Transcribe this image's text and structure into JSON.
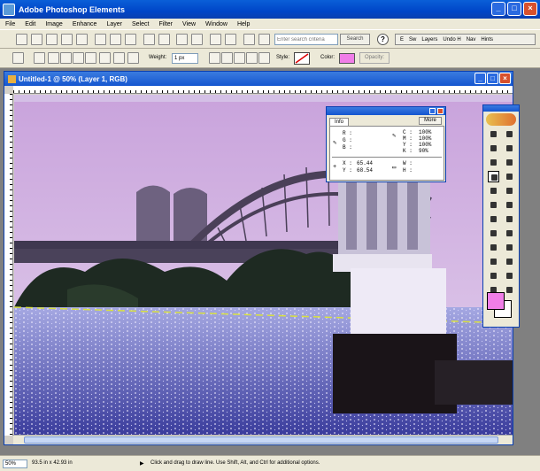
{
  "app": {
    "title": "Adobe Photoshop Elements"
  },
  "menu": [
    "File",
    "Edit",
    "Image",
    "Enhance",
    "Layer",
    "Select",
    "Filter",
    "View",
    "Window",
    "Help"
  ],
  "search": {
    "placeholder": "Enter search criteria",
    "button_label": "Search"
  },
  "palette_well": {
    "tabs": [
      "E",
      "Sw",
      "Layers",
      "Undo H",
      "Nav",
      "Hints"
    ]
  },
  "options": {
    "weight_label": "Weight:",
    "weight_value": "1 px",
    "style_label": "Style:",
    "color_label": "Color:",
    "opacity_label": "Opacity:",
    "color": "#f07ee8"
  },
  "document": {
    "title": "Untitled-1 @ 50% (Layer 1, RGB)"
  },
  "info_palette": {
    "tab": "Info",
    "more_button": "More",
    "r": "R :",
    "g": "G :",
    "b": "B :",
    "c": "C :",
    "m": "M :",
    "y": "Y :",
    "k": "K :",
    "c_val": "100%",
    "m_val": "100%",
    "y_val": "100%",
    "k_val": "90%",
    "x": "X :",
    "y_coord": "Y :",
    "x_val": "65.44",
    "y_val2": "68.54",
    "w": "W :",
    "h": "H :"
  },
  "toolbox": {
    "foreground_color": "#f07ee8",
    "background_color": "#ffffff"
  },
  "status": {
    "zoom": "50%",
    "dims": "93.5 in x 42.93 in",
    "hint": "Click and drag to draw line. Use Shift, Alt, and Ctrl for additional options."
  }
}
